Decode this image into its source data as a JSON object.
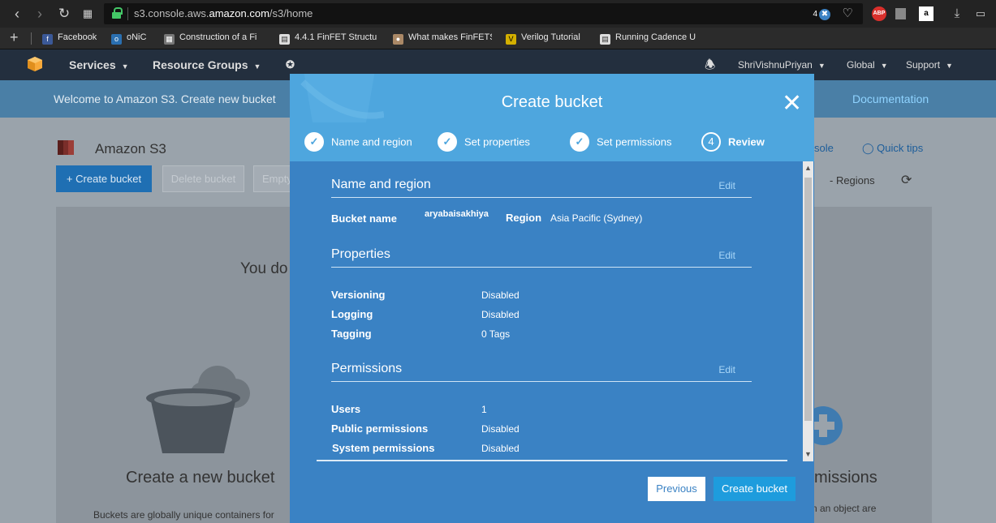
{
  "browser": {
    "url_host": "s3.console.aws.amazon.com",
    "url_prefix": "s3.console.aws.",
    "url_domain": "amazon.com",
    "url_path": "/s3/home",
    "tab_counter": "4",
    "bookmarks": [
      {
        "label": "Facebook",
        "icon": "facebook-icon",
        "color": "#3b5998"
      },
      {
        "label": "oNiC",
        "icon": "onic-icon",
        "color": "#2a6fb0"
      },
      {
        "label": "Construction of a Fi",
        "icon": "globe-icon",
        "color": "#777777"
      },
      {
        "label": "4.4.1 FinFET Structu",
        "icon": "document-icon",
        "color": "#dddddd"
      },
      {
        "label": "What makes FinFETS",
        "icon": "person-icon",
        "color": "#aa8866"
      },
      {
        "label": "Verilog Tutorial",
        "icon": "verilog-icon",
        "color": "#d4b000"
      },
      {
        "label": "Running Cadence U",
        "icon": "document-icon",
        "color": "#dddddd"
      }
    ]
  },
  "aws_nav": {
    "services": "Services",
    "resource_groups": "Resource Groups",
    "user": "ShriVishnuPriyan",
    "region": "Global",
    "support": "Support"
  },
  "welcome": {
    "text": "Welcome to Amazon S3. Create new bucket",
    "documentation": "Documentation"
  },
  "console": {
    "title": "Amazon S3",
    "create_bucket": "Create bucket",
    "delete_bucket": "Delete bucket",
    "empty": "Empty",
    "console_link": "sole",
    "quick_tips": "Quick tips",
    "regions": "- Regions",
    "panel_text": "You do",
    "create_new_bucket": "Create a new bucket",
    "buckets_sub": "Buckets are globally unique containers for",
    "permissions_partial": "missions",
    "object_partial": "n an object are"
  },
  "modal": {
    "title": "Create bucket",
    "steps": [
      {
        "label": "Name and region",
        "state": "done"
      },
      {
        "label": "Set properties",
        "state": "done"
      },
      {
        "label": "Set permissions",
        "state": "done"
      },
      {
        "label": "Review",
        "number": "4",
        "state": "active"
      }
    ],
    "sections": {
      "name_region": {
        "title": "Name and region",
        "edit": "Edit",
        "bucket_name_key": "Bucket name",
        "bucket_name_val": "aryabaisakhiya",
        "region_key": "Region",
        "region_val": "Asia Pacific (Sydney)"
      },
      "properties": {
        "title": "Properties",
        "edit": "Edit",
        "rows": [
          {
            "key": "Versioning",
            "value": "Disabled"
          },
          {
            "key": "Logging",
            "value": "Disabled"
          },
          {
            "key": "Tagging",
            "value": "0 Tags"
          }
        ]
      },
      "permissions": {
        "title": "Permissions",
        "edit": "Edit",
        "rows": [
          {
            "key": "Users",
            "value": "1"
          },
          {
            "key": "Public permissions",
            "value": "Disabled"
          },
          {
            "key": "System permissions",
            "value": "Disabled"
          }
        ]
      }
    },
    "previous": "Previous",
    "create": "Create bucket"
  },
  "colors": {
    "aws_nav": "#232f3e",
    "modal_header": "#4ea6de",
    "modal_body": "#3a82c4",
    "primary_button": "#1e9cdd"
  }
}
